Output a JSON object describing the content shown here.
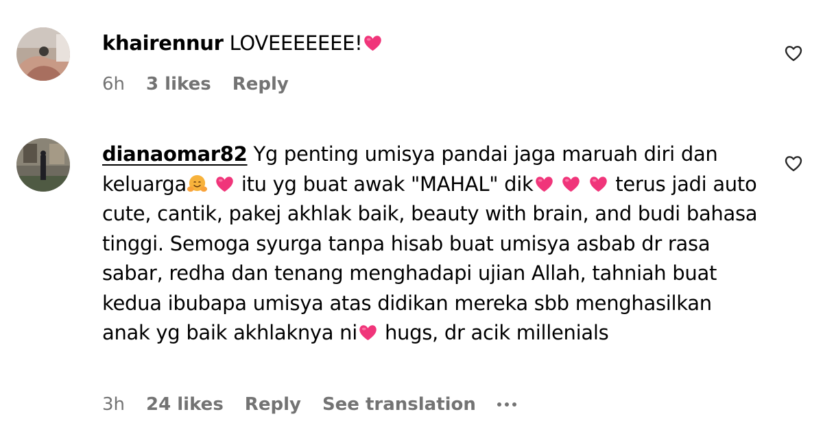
{
  "comments": [
    {
      "username": "khairennur",
      "text_parts": [
        "LOVEEEEEEE!"
      ],
      "time": "6h",
      "likes": "3 likes",
      "reply_label": "Reply"
    },
    {
      "username": "dianaomar82",
      "text_parts": [
        "Yg penting umisya pandai jaga maruah diri dan keluarga",
        "itu yg buat awak \"MAHAL\" dik",
        "terus jadi auto cute, cantik, pakej akhlak baik, beauty with brain, and budi bahasa tinggi. Semoga syurga tanpa hisab buat umisya asbab dr rasa sabar, redha dan tenang menghadapi ujian Allah, tahniah buat kedua ibubapa umisya atas didikan mereka sbb menghasilkan anak yg baik akhlaknya ni",
        "hugs, dr acik millenials"
      ],
      "time": "3h",
      "likes": "24 likes",
      "reply_label": "Reply",
      "translation_label": "See translation"
    }
  ],
  "icons": {
    "heart_emoji": "heart-emoji",
    "hugging_emoji": "hugging-face-emoji",
    "like": "heart-outline-icon",
    "more": "more-dots-icon"
  },
  "colors": {
    "text": "#000000",
    "meta": "#737373",
    "heart_emoji": "#f0357a",
    "hug_emoji": "#f7b23b"
  }
}
